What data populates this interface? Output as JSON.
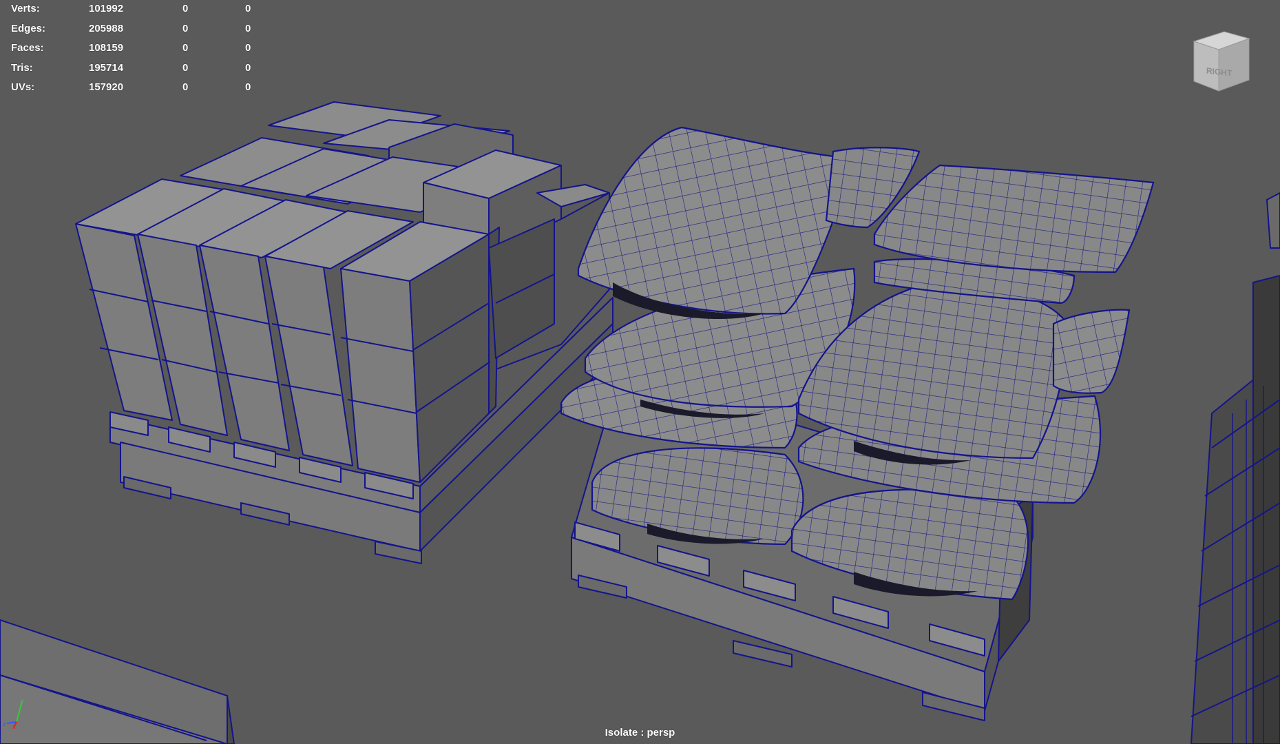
{
  "hud": {
    "rows": [
      {
        "label": "Verts:",
        "v1": "101992",
        "v2": "0",
        "v3": "0"
      },
      {
        "label": "Edges:",
        "v1": "205988",
        "v2": "0",
        "v3": "0"
      },
      {
        "label": "Faces:",
        "v1": "108159",
        "v2": "0",
        "v3": "0"
      },
      {
        "label": "Tris:",
        "v1": "195714",
        "v2": "0",
        "v3": "0"
      },
      {
        "label": "UVs:",
        "v1": "157920",
        "v2": "0",
        "v3": "0"
      }
    ]
  },
  "viewcube": {
    "face_label": "RIGHT"
  },
  "axis": {
    "x": "x",
    "y": "y",
    "z": "z"
  },
  "camera_label": "Isolate : persp",
  "colors": {
    "background": "#5a5a5a",
    "wireframe": "#14148c",
    "face_light": "#8a8a8a",
    "face_mid": "#6e6e6e",
    "face_dark": "#4a4a4a",
    "hud_text": "#ffffff"
  },
  "icons": [
    "viewcube-icon",
    "axis-gizmo-icon"
  ]
}
